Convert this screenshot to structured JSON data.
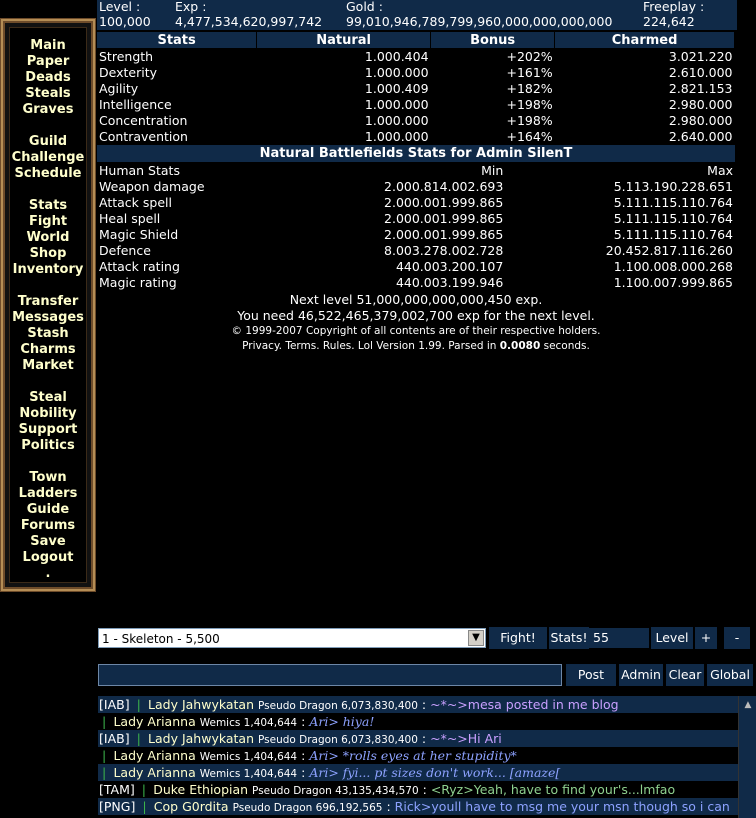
{
  "sidebar": {
    "groups": [
      [
        "Main",
        "Paper",
        "Deads",
        "Steals",
        "Graves"
      ],
      [
        "Guild",
        "Challenge",
        "Schedule"
      ],
      [
        "Stats",
        "Fight",
        "World",
        "Shop",
        "Inventory"
      ],
      [
        "Transfer",
        "Messages",
        "Stash",
        "Charms",
        "Market"
      ],
      [
        "Steal",
        "Nobility",
        "Support",
        "Politics"
      ],
      [
        "Town",
        "Ladders",
        "Guide",
        "Forums",
        "Save",
        "Logout",
        "."
      ]
    ]
  },
  "topbar": {
    "level_label": "Level :",
    "level": "100,000",
    "exp_label": "Exp :",
    "exp": "4,477,534,620,997,742",
    "gold_label": "Gold :",
    "gold": "99,010,946,789,799,960,000,000,000,000",
    "freeplay_label": "Freeplay :",
    "freeplay": "224,642"
  },
  "stats": {
    "headers": [
      "Stats",
      "Natural",
      "Bonus",
      "Charmed"
    ],
    "rows": [
      [
        "Strength",
        "1.000.404",
        "+202%",
        "3.021.220"
      ],
      [
        "Dexterity",
        "1.000.000",
        "+161%",
        "2.610.000"
      ],
      [
        "Agility",
        "1.000.409",
        "+182%",
        "2.821.153"
      ],
      [
        "Intelligence",
        "1.000.000",
        "+198%",
        "2.980.000"
      ],
      [
        "Concentration",
        "1.000.000",
        "+198%",
        "2.980.000"
      ],
      [
        "Contravention",
        "1.000.000",
        "+164%",
        "2.640.000"
      ]
    ]
  },
  "battle": {
    "title": "Natural Battlefields Stats for Admin SilenT",
    "headers": [
      "Human Stats",
      "Min",
      "Max"
    ],
    "rows": [
      [
        "Weapon damage",
        "2.000.814.002.693",
        "5.113.190.228.651"
      ],
      [
        "Attack spell",
        "2.000.001.999.865",
        "5.111.115.110.764"
      ],
      [
        "Heal spell",
        "2.000.001.999.865",
        "5.111.115.110.764"
      ],
      [
        "Magic Shield",
        "2.000.001.999.865",
        "5.111.115.110.764"
      ],
      [
        "Defence",
        "8.003.278.002.728",
        "20.452.817.116.260"
      ],
      [
        "Attack rating",
        "440.003.200.107",
        "1.100.008.000.268"
      ],
      [
        "Magic rating",
        "440.003.199.946",
        "1.100.007.999.865"
      ]
    ]
  },
  "footer": {
    "next_level": "Next level 51,000,000,000,000,450 exp.",
    "need": "You need 46,522,465,379,002,700 exp for the next level.",
    "copyright": "© 1999-2007 Copyright of all contents are of their respective holders.",
    "links_prefix": "Privacy. Terms. Rules. Lol Version 1.99. Parsed in ",
    "parse_time": "0.0080",
    "links_suffix": " seconds."
  },
  "controls": {
    "monster": "1 - Skeleton - 5,500",
    "fight": "Fight!",
    "stats": "Stats!",
    "qty": "55",
    "level": "Level",
    "plus": "+",
    "minus": "-"
  },
  "chat": {
    "post": "Post",
    "admin": "Admin",
    "clear": "Clear",
    "global": "Global",
    "messages": [
      {
        "tag": "[IAB]",
        "name": "Lady Jahwykatan",
        "cls": "Pseudo Dragon 6,073,830,400",
        "sep": ":",
        "text": "~*~>mesa posted in me blog",
        "color": "#c9a0ff",
        "italic": false,
        "alt": true
      },
      {
        "tag": "",
        "name": "Lady Arianna",
        "cls": "Wemics 1,404,644",
        "sep": ":",
        "text": "Ari> hiya!",
        "color": "#8da2ff",
        "italic": true,
        "alt": false
      },
      {
        "tag": "[IAB]",
        "name": "Lady Jahwykatan",
        "cls": "Pseudo Dragon 6,073,830,400",
        "sep": ":",
        "text": "~*~>Hi Ari",
        "color": "#c9a0ff",
        "italic": false,
        "alt": true
      },
      {
        "tag": "",
        "name": "Lady Arianna",
        "cls": "Wemics 1,404,644",
        "sep": ":",
        "text": "Ari> *rolls eyes at her stupidity*",
        "color": "#8da2ff",
        "italic": true,
        "alt": false
      },
      {
        "tag": "",
        "name": "Lady Arianna",
        "cls": "Wemics 1,404,644",
        "sep": ":",
        "text": "Ari> fyi... pt sizes don't work... [amaze[",
        "color": "#8da2ff",
        "italic": true,
        "alt": true
      },
      {
        "tag": "[TAM]",
        "name": "Duke Ethiopian",
        "cls": "Pseudo Dragon 43,135,434,570",
        "sep": ":",
        "text": "<Ryz>Yeah, have to find your's...lmfao",
        "color": "#8fd18f",
        "italic": false,
        "alt": false
      },
      {
        "tag": "[PNG]",
        "name": "Cop G0rdita",
        "cls": "Pseudo Dragon 696,192,565",
        "sep": ":",
        "text": "Rick>youll have to msg me your msn though so i can",
        "color": "#8da2ff",
        "italic": false,
        "alt": true
      }
    ]
  }
}
